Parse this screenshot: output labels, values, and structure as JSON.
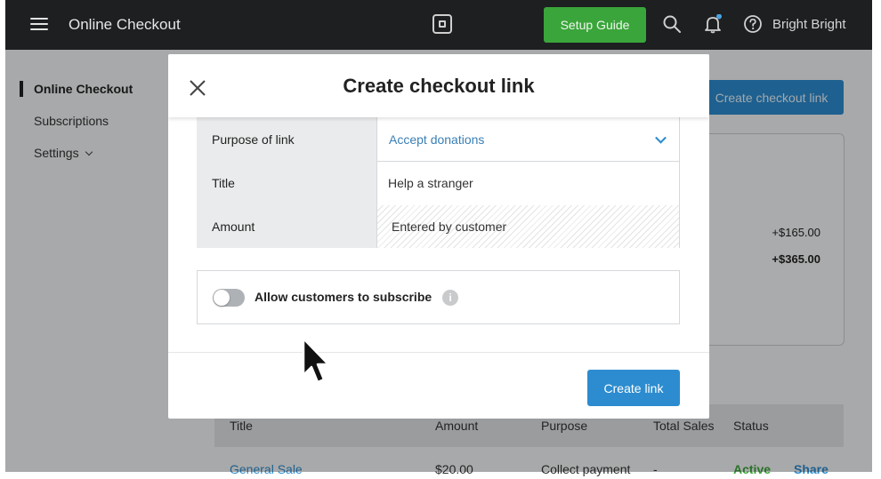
{
  "topbar": {
    "menu_icon": "hamburger-icon",
    "app_title": "Online Checkout",
    "logo_icon": "square-logo-icon",
    "setup_guide_label": "Setup Guide",
    "search_icon": "search-icon",
    "notification_icon": "bell-icon",
    "help_icon": "question-icon",
    "user_name": "Bright Bright",
    "colors": {
      "bar": "#1d1f21",
      "setup_button": "#3aa53a"
    }
  },
  "sidebar": {
    "items": [
      {
        "label": "Online Checkout",
        "active": true
      },
      {
        "label": "Subscriptions",
        "active": false
      },
      {
        "label": "Settings",
        "active": false,
        "icon": "chevron-down-icon"
      }
    ]
  },
  "background": {
    "create_button_label": "Create checkout link",
    "amounts": [
      "+$165.00",
      "+$365.00"
    ],
    "table": {
      "headers": [
        "Title",
        "Amount",
        "Purpose",
        "Total Sales",
        "Status"
      ],
      "rows": [
        {
          "title": "General Sale",
          "amount": "$20.00",
          "purpose": "Collect payment",
          "total_sales": "-",
          "status": "Active",
          "action": "Share"
        }
      ]
    }
  },
  "modal": {
    "title": "Create checkout link",
    "close_icon": "close-icon",
    "fields": {
      "purpose": {
        "label": "Purpose of link",
        "value": "Accept donations"
      },
      "title": {
        "label": "Title",
        "value": "Help a stranger"
      },
      "amount": {
        "label": "Amount",
        "value": "Entered by customer"
      }
    },
    "subscribe": {
      "label": "Allow customers to subscribe",
      "enabled": false,
      "info_icon": "info-icon"
    },
    "create_button_label": "Create link",
    "colors": {
      "primary": "#2c8ccf",
      "active_status": "#3aa53a"
    }
  }
}
